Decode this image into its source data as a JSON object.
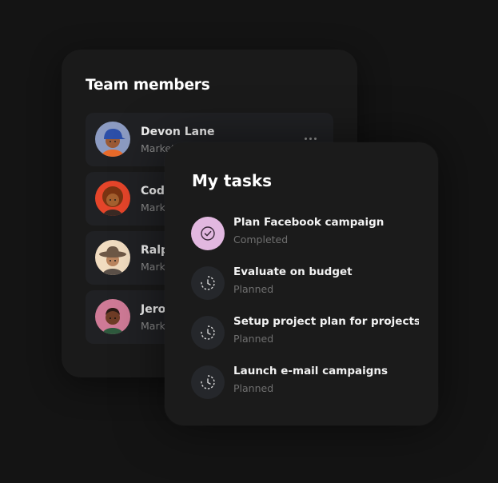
{
  "team": {
    "title": "Team members",
    "members": [
      {
        "name": "Devon Lane",
        "role": "Marketing",
        "avatar": "avatar-blue-cap"
      },
      {
        "name": "Cody Fisher",
        "role": "Marketing",
        "avatar": "avatar-red-curly"
      },
      {
        "name": "Ralph Edwards",
        "role": "Marketing",
        "avatar": "avatar-hat"
      },
      {
        "name": "Jerome Bell",
        "role": "Marketing",
        "avatar": "avatar-pink"
      }
    ],
    "menu_icon": "more-horizontal-icon"
  },
  "tasks": {
    "title": "My tasks",
    "items": [
      {
        "name": "Plan Facebook campaign",
        "status": "Completed",
        "icon": "check-circle-icon",
        "accent": "#e2b8e0"
      },
      {
        "name": "Evaluate on budget",
        "status": "Planned",
        "icon": "clock-icon"
      },
      {
        "name": "Setup project plan for  projects i…",
        "status": "Planned",
        "icon": "clock-icon"
      },
      {
        "name": "Launch e-mail campaigns",
        "status": "Planned",
        "icon": "clock-icon"
      }
    ]
  },
  "colors": {
    "background": "#141414",
    "card": "#1a1a1a",
    "row": "#202124",
    "completed_accent": "#e2b8e0"
  }
}
